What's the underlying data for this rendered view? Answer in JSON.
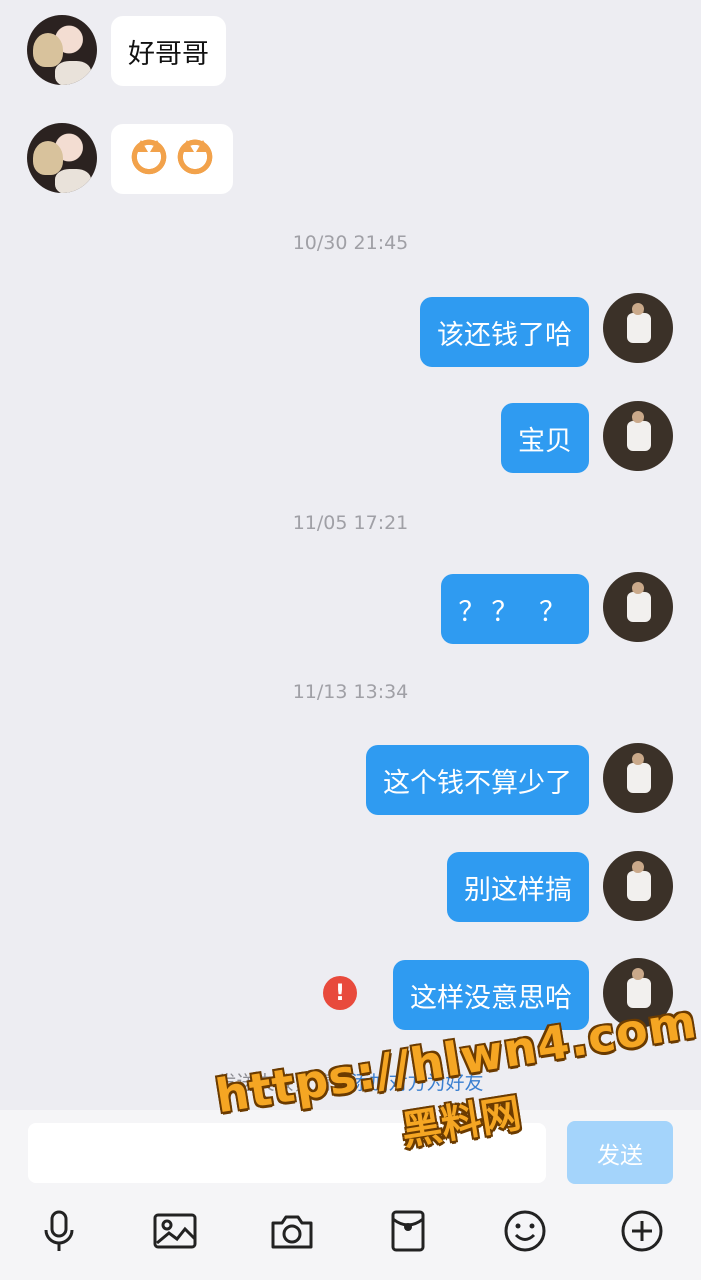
{
  "messages": {
    "m1": "好哥哥",
    "m3": "该还钱了哈",
    "m4": "宝贝",
    "m5": "？？ ？",
    "m6": "这个钱不算少了",
    "m7": "别这样搞",
    "m8": "这样没意思哈"
  },
  "timestamps": {
    "t1": "10/30 21:45",
    "t2": "11/05 17:21",
    "t3": "11/13 13:34"
  },
  "failed_icon": "!",
  "notice": {
    "prefix": "发送失败，请先",
    "link": "添加对方为好友"
  },
  "composer": {
    "send_label": "发送"
  },
  "toolbar_icons": [
    "microphone-icon",
    "image-icon",
    "camera-icon",
    "red-packet-icon",
    "emoji-icon",
    "plus-icon"
  ],
  "watermark": {
    "url": "https://hlwn4.com",
    "site": "黑料网"
  },
  "colors": {
    "background": "#ededf2",
    "outgoing_bubble": "#2f9bf1",
    "incoming_bubble": "#ffffff",
    "send_button": "#a4d4fb",
    "error": "#e84a3c",
    "link": "#3a7fd0",
    "watermark": "#f5a623"
  }
}
